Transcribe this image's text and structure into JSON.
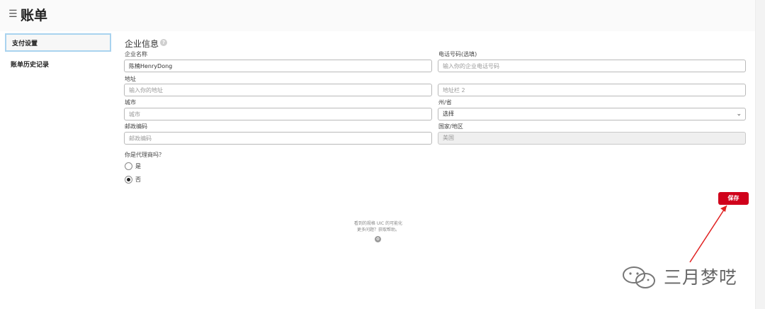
{
  "header": {
    "menu_icon": "☰",
    "title": "账单"
  },
  "sidebar": {
    "items": [
      {
        "label": "支付设置",
        "active": true
      },
      {
        "label": "账单历史记录",
        "active": false
      }
    ]
  },
  "section": {
    "title": "企业信息",
    "help_icon": "?"
  },
  "form": {
    "company_name": {
      "label": "企业名称",
      "value": "陈楠HenryDong"
    },
    "phone": {
      "label": "电话号码(选填)",
      "placeholder": "输入你的企业电话号码"
    },
    "address": {
      "label": "地址",
      "placeholder": "输入你的地址"
    },
    "address2": {
      "placeholder": "地址栏 2"
    },
    "city": {
      "label": "城市",
      "placeholder": "城市"
    },
    "state": {
      "label": "州/省",
      "value": "选择",
      "chevron": "⌄"
    },
    "postal_code": {
      "label": "邮政编码",
      "placeholder": "邮政编码"
    },
    "country": {
      "label": "国家/地区",
      "value": "美国"
    }
  },
  "agency": {
    "question": "你是代理商吗？",
    "options": [
      {
        "label": "是",
        "checked": false
      },
      {
        "label": "否",
        "checked": true
      }
    ]
  },
  "save_label": "保存",
  "footer": {
    "line1": "看到的规格 UIC 的可能化",
    "line2": "更多问题？获取帮助。",
    "icon": "⚙"
  },
  "watermark": {
    "text": "三月梦呓"
  },
  "colors": {
    "accent": "#d0011b",
    "active_border": "#a9d3ef"
  }
}
